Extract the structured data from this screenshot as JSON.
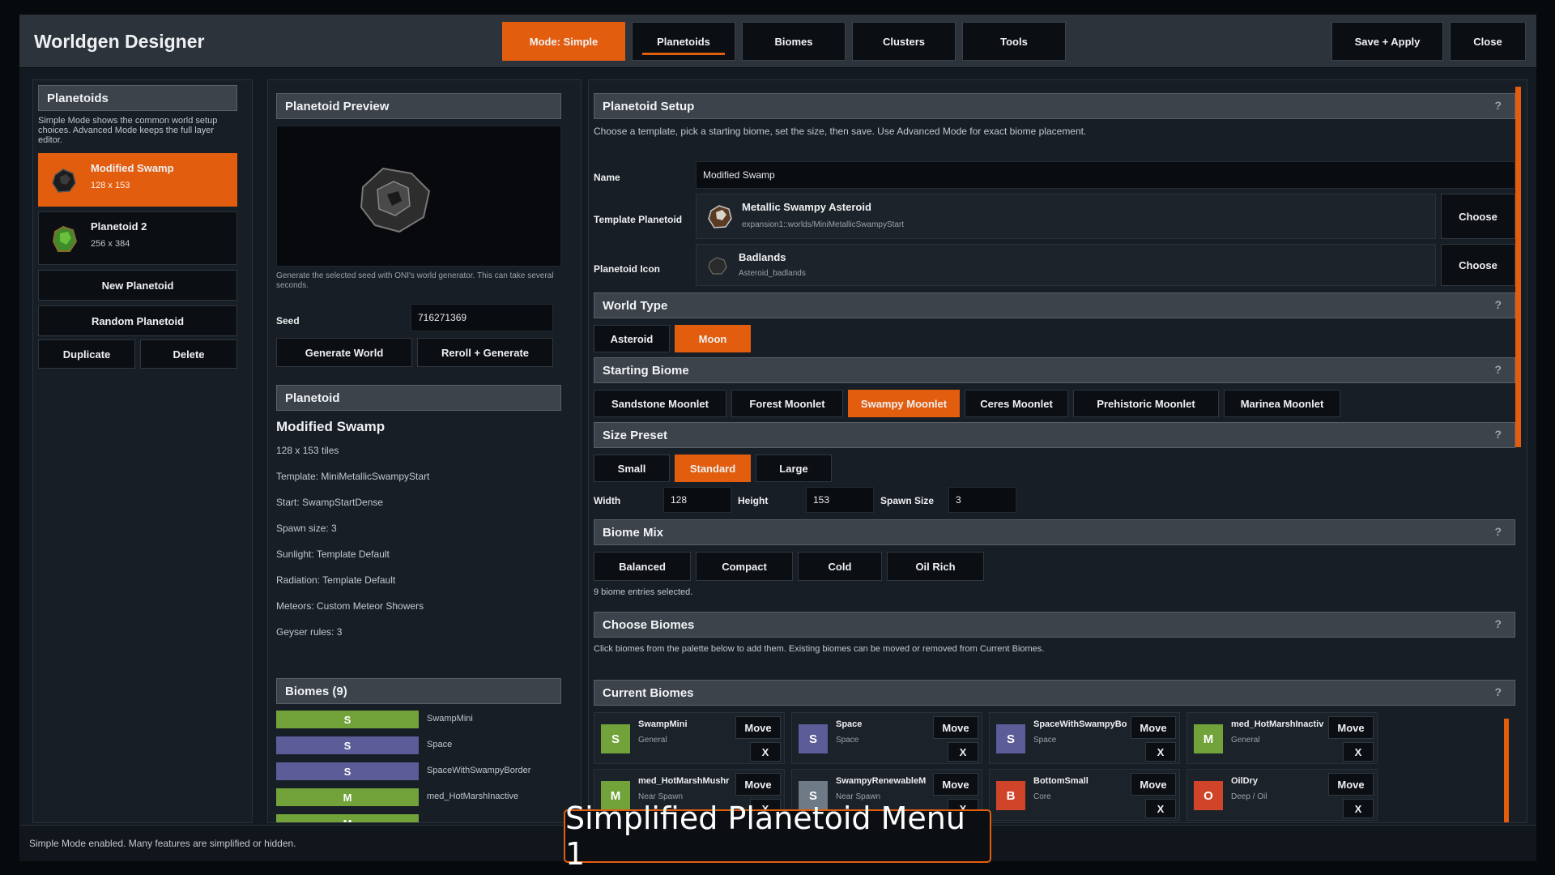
{
  "app": {
    "title": "Worldgen Designer"
  },
  "top_tabs": {
    "mode": "Mode: Simple",
    "planetoids": "Planetoids",
    "biomes": "Biomes",
    "clusters": "Clusters",
    "tools": "Tools"
  },
  "top_actions": {
    "save": "Save + Apply",
    "close": "Close"
  },
  "left": {
    "header": "Planetoids",
    "note": "Simple Mode shows the common world setup choices. Advanced Mode keeps the full layer editor.",
    "items": [
      {
        "name": "Modified Swamp",
        "size": "128 x 153"
      },
      {
        "name": "Planetoid 2",
        "size": "256 x 384"
      }
    ],
    "new_btn": "New Planetoid",
    "random_btn": "Random Planetoid",
    "duplicate_btn": "Duplicate",
    "delete_btn": "Delete"
  },
  "preview": {
    "header": "Planetoid Preview",
    "note": "Generate the selected seed with ONI's world generator. This can take several seconds.",
    "seed_label": "Seed",
    "seed_value": "716271369",
    "generate_btn": "Generate World",
    "reroll_btn": "Reroll + Generate"
  },
  "summary": {
    "header": "Planetoid",
    "name": "Modified Swamp",
    "tiles": "128 x 153 tiles",
    "template": "Template: MiniMetallicSwampyStart",
    "start": "Start: SwampStartDense",
    "spawn": "Spawn size: 3",
    "sunlight": "Sunlight: Template Default",
    "radiation": "Radiation: Template Default",
    "meteors": "Meteors: Custom Meteor Showers",
    "geysers": "Geyser rules: 3"
  },
  "biomes_list": {
    "header": "Biomes (9)",
    "rows": [
      {
        "letter": "S",
        "name": "SwampMini",
        "color": "#72a33a"
      },
      {
        "letter": "S",
        "name": "Space",
        "color": "#5b5c98"
      },
      {
        "letter": "S",
        "name": "SpaceWithSwampyBorder",
        "color": "#5b5c98"
      },
      {
        "letter": "M",
        "name": "med_HotMarshInactive",
        "color": "#72a33a"
      },
      {
        "letter": "M",
        "name": "",
        "color": "#72a33a"
      }
    ]
  },
  "setup": {
    "header": "Planetoid Setup",
    "help": "?",
    "desc": "Choose a template, pick a starting biome, set the size, then save. Use Advanced Mode for exact biome placement.",
    "name_label": "Name",
    "name_value": "Modified Swamp",
    "template_label": "Template Planetoid",
    "template_name": "Metallic Swampy Asteroid",
    "template_path": "expansion1::worlds/MiniMetallicSwampyStart",
    "icon_label": "Planetoid Icon",
    "icon_name": "Badlands",
    "icon_id": "Asteroid_badlands",
    "choose": "Choose"
  },
  "world_type": {
    "header": "World Type",
    "options": [
      "Asteroid",
      "Moon"
    ],
    "selected": "Moon"
  },
  "starting_biome": {
    "header": "Starting Biome",
    "options": [
      "Sandstone Moonlet",
      "Forest Moonlet",
      "Swampy Moonlet",
      "Ceres Moonlet",
      "Prehistoric Moonlet",
      "Marinea Moonlet"
    ],
    "selected": "Swampy Moonlet"
  },
  "size_preset": {
    "header": "Size Preset",
    "options": [
      "Small",
      "Standard",
      "Large"
    ],
    "selected": "Standard",
    "width_label": "Width",
    "width": "128",
    "height_label": "Height",
    "height": "153",
    "spawn_label": "Spawn Size",
    "spawn": "3"
  },
  "biome_mix": {
    "header": "Biome Mix",
    "options": [
      "Balanced",
      "Compact",
      "Cold",
      "Oil Rich"
    ],
    "status": "9 biome entries selected."
  },
  "choose_biomes": {
    "header": "Choose Biomes",
    "desc": "Click biomes from the palette below to add them. Existing biomes can be moved or removed from Current Biomes."
  },
  "current_biomes": {
    "header": "Current Biomes",
    "move": "Move",
    "remove": "X",
    "cards": [
      {
        "letter": "S",
        "name": "SwampMini",
        "sub": "General",
        "color": "#72a33a"
      },
      {
        "letter": "S",
        "name": "Space",
        "sub": "Space",
        "color": "#5b5c98"
      },
      {
        "letter": "S",
        "name": "SpaceWithSwampyBo",
        "sub": "Space",
        "color": "#5b5c98"
      },
      {
        "letter": "M",
        "name": "med_HotMarshInactiv",
        "sub": "General",
        "color": "#72a33a"
      },
      {
        "letter": "M",
        "name": "med_HotMarshMushr",
        "sub": "Near Spawn",
        "color": "#72a33a"
      },
      {
        "letter": "S",
        "name": "SwampyRenewableM",
        "sub": "Near Spawn",
        "color": "#6e7a86"
      },
      {
        "letter": "B",
        "name": "BottomSmall",
        "sub": "Core",
        "color": "#d0452a"
      },
      {
        "letter": "O",
        "name": "OilDry",
        "sub": "Deep / Oil",
        "color": "#d0452a"
      }
    ]
  },
  "status_bar": {
    "text": "Simple Mode enabled. Many features are simplified or hidden."
  },
  "caption": {
    "text": "Simplified Planetoid Menu 1"
  }
}
